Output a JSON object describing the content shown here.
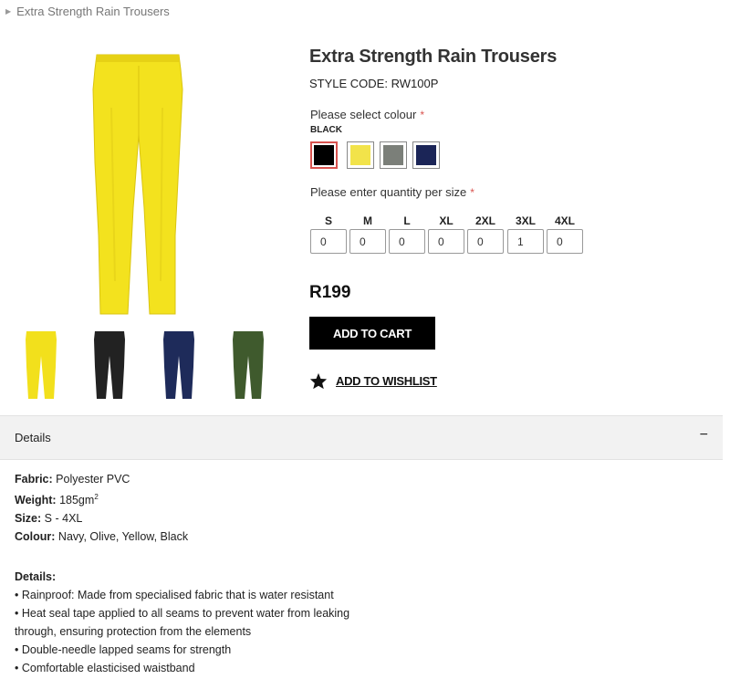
{
  "breadcrumb": {
    "caret_icon": "chevron-right-icon",
    "current": "Extra Strength Rain Trousers"
  },
  "product": {
    "title": "Extra Strength Rain Trousers",
    "style_code": "STYLE CODE: RW100P",
    "price": "R199"
  },
  "colour": {
    "label": "Please select colour",
    "required_mark": "*",
    "selected": "BLACK",
    "swatches": [
      {
        "name": "Black",
        "color": "#000000",
        "selected": true
      },
      {
        "name": "Yellow",
        "color": "#f2e34a",
        "selected": false
      },
      {
        "name": "Grey",
        "color": "#7b7f79",
        "selected": false
      },
      {
        "name": "Navy",
        "color": "#1b2557",
        "selected": false
      }
    ]
  },
  "quantity": {
    "label": "Please enter quantity per size",
    "required_mark": "*",
    "sizes": [
      {
        "size": "S",
        "value": "0"
      },
      {
        "size": "M",
        "value": "0"
      },
      {
        "size": "L",
        "value": "0"
      },
      {
        "size": "XL",
        "value": "0"
      },
      {
        "size": "2XL",
        "value": "0"
      },
      {
        "size": "3XL",
        "value": "1"
      },
      {
        "size": "4XL",
        "value": "0"
      }
    ]
  },
  "actions": {
    "add_to_cart": "ADD TO CART",
    "wishlist": "ADD TO WISHLIST",
    "wishlist_icon": "star-icon"
  },
  "thumbnails": [
    {
      "colour": "Yellow",
      "color": "#f2e01c"
    },
    {
      "colour": "Black",
      "color": "#222222"
    },
    {
      "colour": "Navy",
      "color": "#1e2b5a"
    },
    {
      "colour": "Olive",
      "color": "#3f5a2d"
    }
  ],
  "details": {
    "title": "Details",
    "toggle": "−",
    "fabric_label": "Fabric:",
    "fabric_value": "Polyester PVC",
    "weight_label": "Weight:",
    "weight_value": "185gm",
    "weight_sup": "2",
    "size_label": "Size:",
    "size_value": "S - 4XL",
    "colour_label": "Colour:",
    "colour_value": "Navy, Olive, Yellow, Black",
    "details_heading": "Details:",
    "bullets": [
      "• Rainproof: Made from specialised fabric that is water resistant",
      "• Heat seal tape applied to all seams to prevent water from leaking through, ensuring protection from the elements",
      "• Double-needle lapped seams for strength",
      "• Comfortable elasticised waistband"
    ]
  },
  "colors": {
    "accent_required": "#d9534f",
    "button_bg": "#000000",
    "details_bar_bg": "#f2f2f2"
  }
}
